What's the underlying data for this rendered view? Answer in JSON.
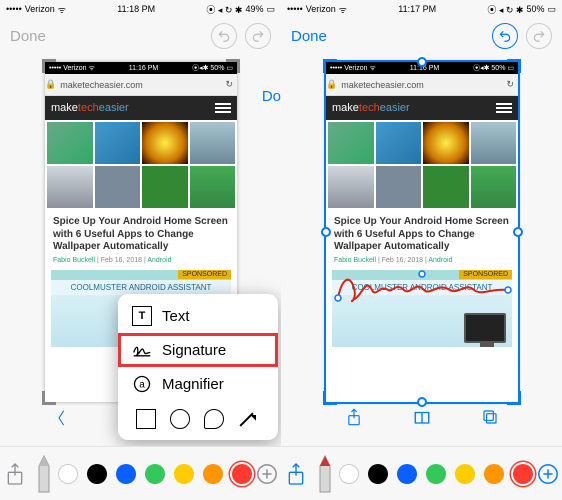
{
  "left": {
    "status": {
      "carrier": "Verizon",
      "time": "11:18 PM",
      "battery": "49%"
    },
    "editbar": {
      "done": "Done"
    },
    "mini": {
      "carrier": "Verizon",
      "time": "11:16 PM",
      "battery": "50%",
      "url": "maketecheasier.com"
    },
    "logo": {
      "p1": "make",
      "p2": "tech",
      "p3": "easier"
    },
    "article": {
      "headline": "Spice Up Your Android Home Screen with 6 Useful Apps to Change Wallpaper Automatically",
      "author": "Fabio Buckell",
      "date": "Feb 16, 2018",
      "category": "Android"
    },
    "sponsor": {
      "tag": "SPONSORED",
      "title": "COOLMUSTER ANDROID ASSISTANT"
    },
    "peek_done": "Do",
    "popover": {
      "text": "Text",
      "signature": "Signature",
      "magnifier": "Magnifier"
    },
    "swatches": [
      "#ffffff",
      "#000000",
      "#0a60ff",
      "#34c759",
      "#ffcc00",
      "#ff9500",
      "#ff3b30"
    ],
    "selected_swatch": 6
  },
  "right": {
    "status": {
      "carrier": "Verizon",
      "time": "11:17 PM",
      "battery": "50%"
    },
    "editbar": {
      "done": "Done"
    },
    "mini": {
      "carrier": "Verizon",
      "time": "11:16 PM",
      "battery": "50%",
      "url": "maketecheasier.com"
    },
    "logo": {
      "p1": "make",
      "p2": "tech",
      "p3": "easier"
    },
    "article": {
      "headline": "Spice Up Your Android Home Screen with 6 Useful Apps to Change Wallpaper Automatically",
      "author": "Fabio Buckell",
      "date": "Feb 16, 2018",
      "category": "Android"
    },
    "sponsor": {
      "tag": "SPONSORED",
      "title": "COOLMUSTER ANDROID ASSISTANT"
    },
    "signature_text": "Alexander Fox",
    "swatches": [
      "#ffffff",
      "#000000",
      "#0a60ff",
      "#34c759",
      "#ffcc00",
      "#ff9500",
      "#ff3b30"
    ],
    "selected_swatch": 6
  }
}
